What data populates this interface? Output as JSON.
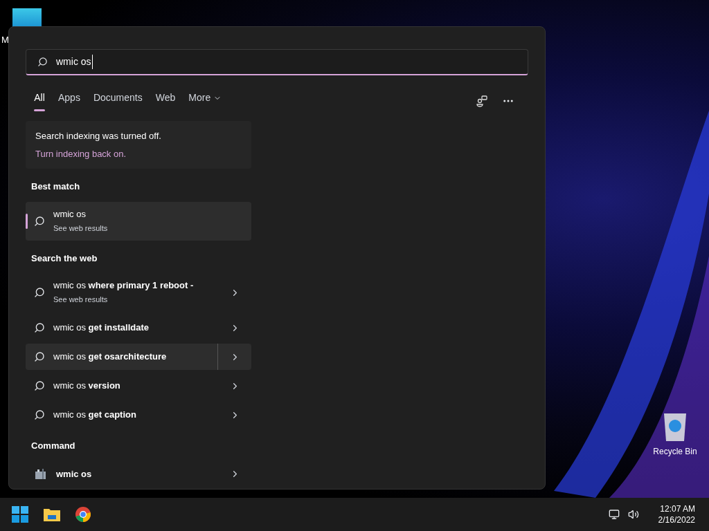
{
  "desktop": {
    "icons": [
      {
        "kind": "app",
        "label": "M"
      },
      {
        "kind": "recycle",
        "label": "Recycle Bin"
      }
    ]
  },
  "search": {
    "value": "wmic os"
  },
  "tabs": [
    {
      "label": "All",
      "selected": true
    },
    {
      "label": "Apps",
      "selected": false
    },
    {
      "label": "Documents",
      "selected": false
    },
    {
      "label": "Web",
      "selected": false
    },
    {
      "label": "More",
      "selected": false,
      "dropdown": true
    }
  ],
  "notice": {
    "title": "Search indexing was turned off.",
    "link": "Turn indexing back on."
  },
  "sections": [
    {
      "heading": "Best match",
      "items": [
        {
          "kind": "best",
          "title": "wmic os",
          "subtitle": "See web results",
          "selected": true,
          "hovered": false
        }
      ]
    },
    {
      "heading": "Search the web",
      "items": [
        {
          "kind": "web",
          "title": "wmic os **where primary 1 reboot -**",
          "subtitle": "See web results",
          "selected": false,
          "hovered": false
        },
        {
          "kind": "web",
          "title": "wmic os **get installdate**",
          "selected": false,
          "hovered": false
        },
        {
          "kind": "web",
          "title": "wmic os **get osarchitecture**",
          "selected": false,
          "hovered": true
        },
        {
          "kind": "web",
          "title": "wmic os **version**",
          "selected": false,
          "hovered": false
        },
        {
          "kind": "web",
          "title": "wmic os **get caption**",
          "selected": false,
          "hovered": false
        }
      ]
    },
    {
      "heading": "Command",
      "items": [
        {
          "kind": "command",
          "title": "wmic os",
          "selected": false,
          "hovered": false
        }
      ]
    }
  ],
  "clock": {
    "time": "12:07 AM",
    "date": "2/16/2022"
  }
}
